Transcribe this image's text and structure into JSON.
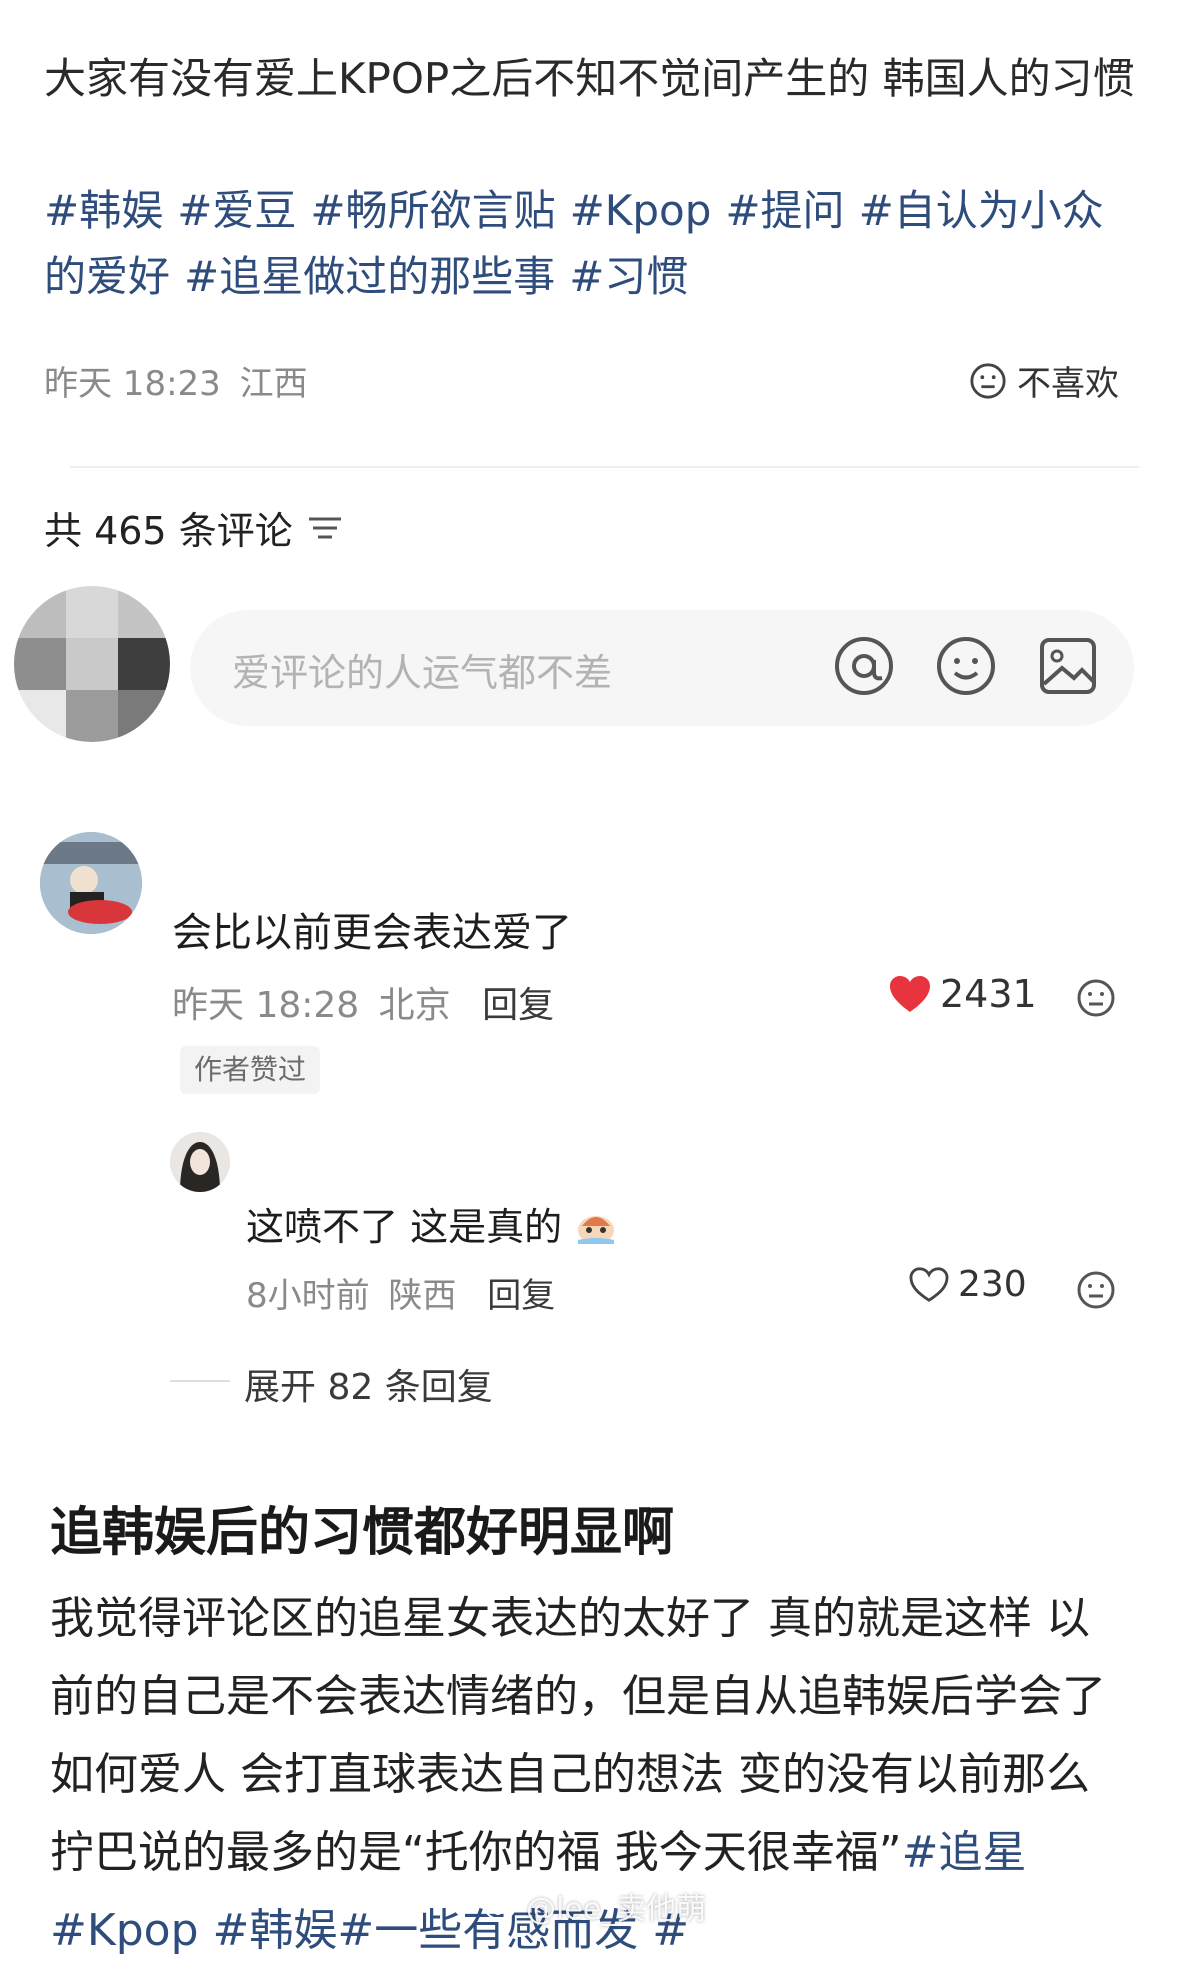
{
  "post": {
    "title": "大家有没有爱上KPOP之后不知不觉间产生的 韩国人的习惯",
    "tags": [
      "#韩娱",
      "#爱豆",
      "#畅所欲言贴",
      "#Kpop",
      "#提问",
      "#自认为小众的爱好",
      "#追星做过的那些事",
      "#习惯"
    ],
    "time": "昨天 18:23",
    "location": "江西",
    "dislike_label": "不喜欢"
  },
  "comments_header": {
    "count_label": "共 465 条评论"
  },
  "input": {
    "placeholder": "爱评论的人运气都不差"
  },
  "comment1": {
    "text": "会比以前更会表达爱了",
    "time": "昨天 18:28",
    "location": "北京",
    "reply_label": "回复",
    "likes": "2431",
    "badge": "作者赞过"
  },
  "comment2": {
    "text": "这喷不了 这是真的",
    "time": "8小时前",
    "location": "陕西",
    "reply_label": "回复",
    "likes": "230"
  },
  "expand_label": "展开 82 条回复",
  "article": {
    "headline": "追韩娱后的习惯都好明显啊",
    "body": "我觉得评论区的追星女表达的太好了 真的就是这样 以前的自己是不会表达情绪的，但是自从追韩娱后学会了如何爱人 会打直球表达自己的想法 变的没有以前那么拧巴说的最多的是“托你的福 我今天很幸福”",
    "tags": "#追星 #Kpop #韩娱#一些有感而发 #"
  },
  "watermark": "@lee_卖他萌",
  "colors": {
    "tag_blue": "#2f4d7c",
    "like_red": "#e8343f",
    "meta_gray": "#8a8a8a"
  }
}
